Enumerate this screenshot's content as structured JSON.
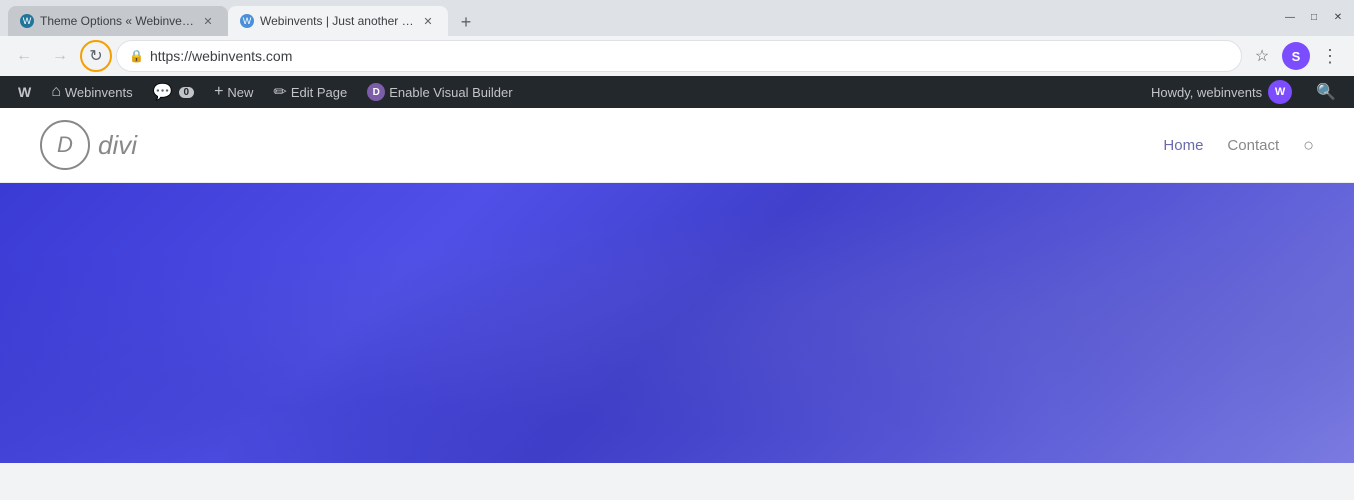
{
  "browser": {
    "tabs": [
      {
        "id": "tab1",
        "title": "Theme Options « Webinvents —",
        "favicon_label": "W",
        "active": false
      },
      {
        "id": "tab2",
        "title": "Webinvents | Just another Word…",
        "favicon_label": "W",
        "active": true
      }
    ],
    "new_tab_label": "+",
    "window_controls": {
      "minimize": "—",
      "maximize": "□",
      "close": "✕"
    },
    "nav": {
      "back_label": "←",
      "forward_label": "→",
      "reload_label": "↻"
    },
    "url": "https://webinvents.com",
    "lock_icon": "🔒",
    "toolbar": {
      "bookmark_icon": "☆",
      "profile_label": "S",
      "more_icon": "⋮"
    }
  },
  "wp_admin_bar": {
    "items": [
      {
        "id": "wp-logo",
        "label": "",
        "icon": "W",
        "type": "wp-logo"
      },
      {
        "id": "site-name",
        "label": "Webinvents",
        "icon": "⌂",
        "type": "site"
      },
      {
        "id": "comments",
        "label": "0",
        "icon": "💬",
        "type": "comments"
      },
      {
        "id": "new",
        "label": "New",
        "icon": "+",
        "type": "new"
      },
      {
        "id": "edit-page",
        "label": "Edit Page",
        "icon": "✏",
        "type": "edit"
      },
      {
        "id": "divi",
        "label": "Enable Visual Builder",
        "icon": "D",
        "type": "divi"
      }
    ],
    "right": {
      "howdy_text": "Howdy, webinvents",
      "avatar_label": "W",
      "search_icon": "🔍"
    }
  },
  "site_header": {
    "logo_letter": "D",
    "logo_text": "divi",
    "nav_links": [
      {
        "label": "Home",
        "active": true
      },
      {
        "label": "Contact",
        "active": false
      }
    ],
    "search_icon": "○"
  },
  "hero": {
    "background_color": "#3a3ad4"
  }
}
